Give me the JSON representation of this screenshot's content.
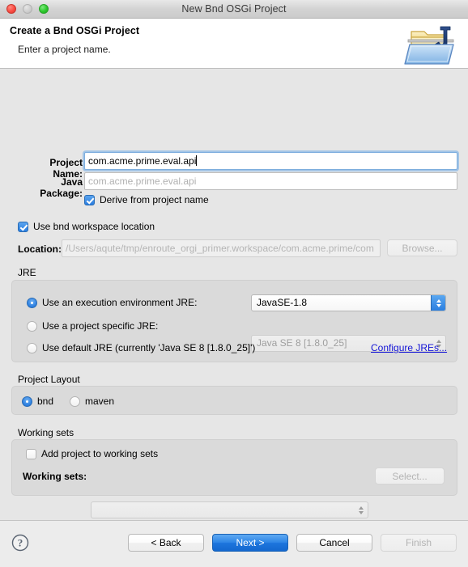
{
  "window": {
    "title": "New Bnd OSGi Project",
    "traffic": {
      "close": "close-button",
      "minimize": "minimize-button",
      "zoom": "zoom-button"
    }
  },
  "header": {
    "title": "Create a Bnd OSGi Project",
    "subtitle": "Enter a project name.",
    "icon": "new-java-project-folder-icon"
  },
  "form": {
    "project_name": {
      "label": "Project Name:",
      "value": "com.acme.prime.eval.api",
      "focused": true
    },
    "java_package": {
      "label": "Java Package:",
      "value": "",
      "placeholder": "com.acme.prime.eval.api",
      "enabled": false
    },
    "derive_checkbox": {
      "label": "Derive from project name",
      "checked": true
    },
    "use_bnd_workspace_checkbox": {
      "label": "Use bnd workspace location",
      "checked": true
    },
    "location": {
      "label": "Location:",
      "value": "/Users/aqute/tmp/enroute_orgi_primer.workspace/com.acme.prime/com",
      "enabled": false
    },
    "browse_button": {
      "label": "Browse...",
      "enabled": false
    }
  },
  "jre": {
    "group_label": "JRE",
    "options": [
      {
        "label": "Use an execution environment JRE:",
        "selected": true,
        "combo_value": "JavaSE-1.8",
        "combo_enabled": true
      },
      {
        "label": "Use a project specific JRE:",
        "selected": false,
        "combo_value": "Java SE 8 [1.8.0_25]",
        "combo_enabled": false
      },
      {
        "label": "Use default JRE (currently 'Java SE 8 [1.8.0_25]')",
        "selected": false
      }
    ],
    "configure_link": "Configure JREs..."
  },
  "project_layout": {
    "group_label": "Project Layout",
    "options": [
      {
        "label": "bnd",
        "selected": true
      },
      {
        "label": "maven",
        "selected": false
      }
    ]
  },
  "working_sets": {
    "group_label": "Working sets",
    "add_checkbox": {
      "label": "Add project to working sets",
      "checked": false
    },
    "select_label": "Working sets:",
    "select_value": "",
    "select_button": {
      "label": "Select...",
      "enabled": false
    }
  },
  "footer": {
    "help_icon": "help-icon",
    "buttons": [
      {
        "label": "< Back",
        "kind": "normal",
        "enabled": true
      },
      {
        "label": "Next >",
        "kind": "default",
        "enabled": true
      },
      {
        "label": "Cancel",
        "kind": "normal",
        "enabled": true
      },
      {
        "label": "Finish",
        "kind": "normal",
        "enabled": false
      }
    ]
  },
  "colors": {
    "accent": "#2a7ee0",
    "link": "#1414d6",
    "window_bg": "#e6e6e6",
    "group_bg": "#dadada"
  }
}
